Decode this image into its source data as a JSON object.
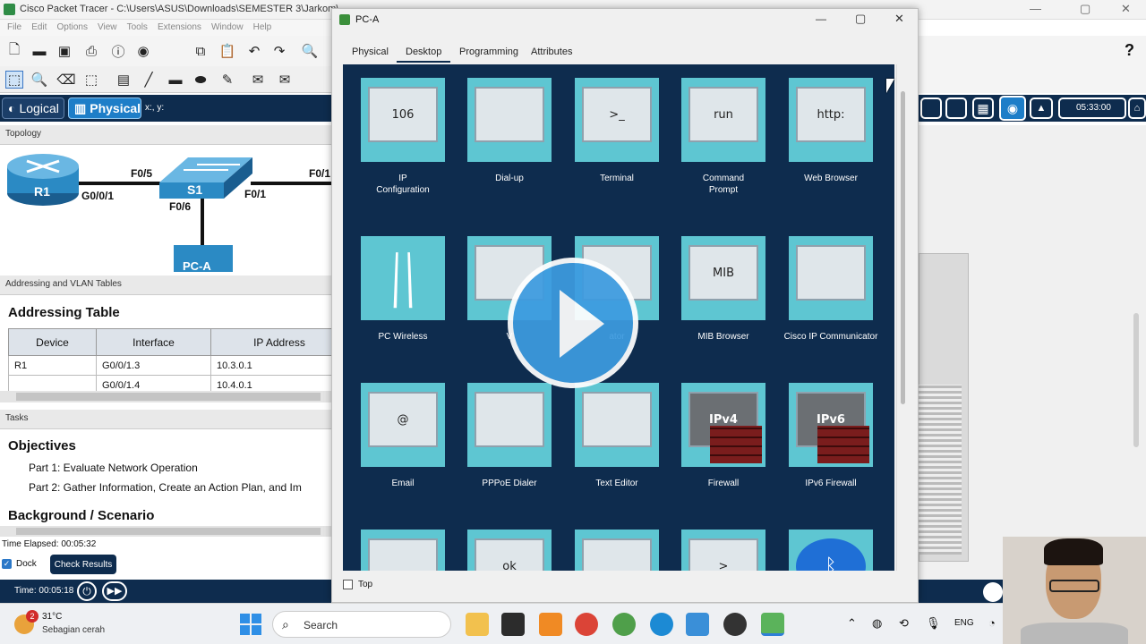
{
  "window": {
    "title": "Cisco Packet Tracer - C:\\Users\\ASUS\\Downloads\\SEMESTER 3\\Jarkom\\",
    "help_glyph": "?"
  },
  "menu": [
    "File",
    "Edit",
    "Options",
    "View",
    "Tools",
    "Extensions",
    "Window",
    "Help"
  ],
  "mode_bar": {
    "logical": "Logical",
    "physical": "Physical",
    "coords": "x:, y:"
  },
  "topology": {
    "header": "Topology",
    "devices": {
      "router": "R1",
      "switch": "S1",
      "pc": "PC-A"
    },
    "ports": {
      "g001": "G0/0/1",
      "f05": "F0/5",
      "f06": "F0/6",
      "f01": "F0/1",
      "f01b": "F0/1"
    }
  },
  "addressing": {
    "header": "Addressing and VLAN Tables",
    "title": "Addressing Table",
    "columns": [
      "Device",
      "Interface",
      "IP Address"
    ],
    "rows": [
      {
        "device": "R1",
        "interface": "G0/0/1.3",
        "ip": "10.3.0.1"
      },
      {
        "device": "",
        "interface": "G0/0/1.4",
        "ip": "10.4.0.1"
      }
    ]
  },
  "tasks": {
    "header": "Tasks",
    "objectives": "Objectives",
    "part1": "Part 1: Evaluate Network Operation",
    "part2": "Part 2: Gather Information, Create an Action Plan, and Im",
    "background": "Background / Scenario"
  },
  "status": {
    "elapsed": "Time Elapsed: 00:05:32",
    "dock": "Dock",
    "check_results": "Check Results",
    "time": "Time: 00:05:18",
    "clock": "05:33:00"
  },
  "pca": {
    "title": "PC-A",
    "tabs": [
      "Physical",
      "Desktop",
      "Programming",
      "Attributes"
    ],
    "active_tab": "Desktop",
    "top_label": "Top",
    "apps": [
      {
        "label": "IP\nConfiguration",
        "icon": "ip-configuration-icon",
        "glyph": "106"
      },
      {
        "label": "Dial-up",
        "icon": "dialup-modem-icon",
        "glyph": ""
      },
      {
        "label": "Terminal",
        "icon": "terminal-icon",
        "glyph": ">_"
      },
      {
        "label": "Command\nPrompt",
        "icon": "command-prompt-icon",
        "glyph": "run"
      },
      {
        "label": "Web Browser",
        "icon": "web-browser-icon",
        "glyph": "http:"
      },
      {
        "label": "PC Wireless",
        "icon": "pc-wireless-icon",
        "glyph": ""
      },
      {
        "label": "V",
        "icon": "vpn-icon",
        "glyph": ""
      },
      {
        "label": "ator",
        "icon": "traffic-generator-icon",
        "glyph": ""
      },
      {
        "label": "MIB Browser",
        "icon": "mib-browser-icon",
        "glyph": "MIB"
      },
      {
        "label": "Cisco IP Communicator",
        "icon": "ip-communicator-icon",
        "glyph": ""
      },
      {
        "label": "Email",
        "icon": "email-icon",
        "glyph": "@"
      },
      {
        "label": "PPPoE Dialer",
        "icon": "pppoe-dialer-icon",
        "glyph": ""
      },
      {
        "label": "Text Editor",
        "icon": "text-editor-icon",
        "glyph": ""
      },
      {
        "label": "Firewall",
        "icon": "firewall-icon",
        "glyph": "IPv4"
      },
      {
        "label": "IPv6 Firewall",
        "icon": "ipv6-firewall-icon",
        "glyph": "IPv6"
      },
      {
        "label": "",
        "icon": "netflow-collector-icon",
        "glyph": ""
      },
      {
        "label": "",
        "icon": "iox-ide-icon",
        "glyph": "ok"
      },
      {
        "label": "",
        "icon": "file-browser-icon",
        "glyph": ""
      },
      {
        "label": "",
        "icon": "telnet-ssh-icon",
        "glyph": ">"
      },
      {
        "label": "",
        "icon": "bluetooth-icon",
        "glyph": "ᛒ"
      }
    ]
  },
  "taskbar": {
    "weather_temp": "31°C",
    "weather_desc": "Sebagian cerah",
    "weather_badge": "2",
    "search": "Search",
    "lang": "ENG"
  },
  "colors": {
    "pt_navy": "#0e2c4e",
    "app_tile": "#5ec6d2",
    "play": "#3d9be0"
  }
}
